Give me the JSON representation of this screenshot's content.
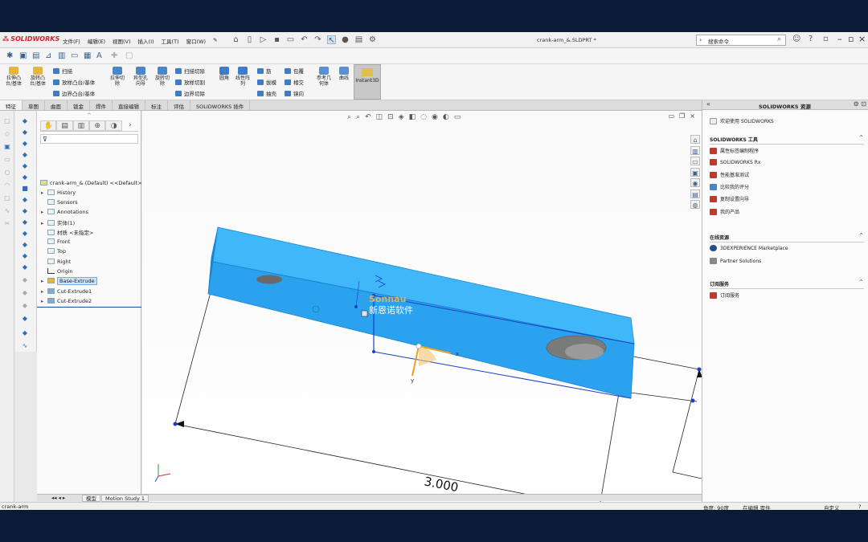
{
  "app": {
    "logo_text": "SOLIDWORKS",
    "document_title": "crank-arm_&.SLDPRT *",
    "search_label": "搜索命令",
    "menu": [
      "文件(F)",
      "编辑(E)",
      "视图(V)",
      "插入(I)",
      "工具(T)",
      "窗口(W)"
    ]
  },
  "commands": {
    "large": [
      {
        "label": "拉伸凸\n台/基体"
      },
      {
        "label": "旋转凸\n台/基体"
      },
      {
        "label": "拉伸切\n除"
      },
      {
        "label": "异型孔\n向导"
      },
      {
        "label": "旋转切\n除"
      },
      {
        "label": "圆角"
      },
      {
        "label": "线性阵\n列"
      },
      {
        "label": "参考几\n何体"
      },
      {
        "label": "曲线"
      }
    ],
    "small": [
      "扫描",
      "放样凸台/基体",
      "边界凸台/基体",
      "扫描切除",
      "放样切割",
      "边界切除",
      "筋",
      "拔模",
      "抽壳",
      "包覆",
      "相交",
      "镜向"
    ],
    "instant3d": "Instant3D"
  },
  "tabs": [
    "特征",
    "草图",
    "曲面",
    "钣金",
    "焊件",
    "直接编辑",
    "标注",
    "评估",
    "SOLIDWORKS 插件"
  ],
  "tree": {
    "root": "crank-arm_& (Default) <<Default>",
    "items": [
      {
        "label": "History",
        "exp": "▸"
      },
      {
        "label": "Sensors",
        "exp": ""
      },
      {
        "label": "Annotations",
        "exp": "▸"
      },
      {
        "label": "实体(1)",
        "exp": "▸"
      },
      {
        "label": "材质 <未指定>",
        "exp": ""
      },
      {
        "label": "Front",
        "exp": ""
      },
      {
        "label": "Top",
        "exp": ""
      },
      {
        "label": "Right",
        "exp": ""
      },
      {
        "label": "Origin",
        "exp": ""
      },
      {
        "label": "Base-Extrude",
        "exp": "▸",
        "selected": true
      },
      {
        "label": "Cut-Extrude1",
        "exp": "▸"
      },
      {
        "label": "Cut-Extrude2",
        "exp": "▸"
      }
    ]
  },
  "viewport": {
    "watermark_en": "Sonnau",
    "watermark_cn": "新恩诺软件",
    "dimension_value": "3.000",
    "triad_x": "x",
    "triad_y": "y",
    "part_color": "#2fa7f0",
    "accent_color": "#1b3fc7"
  },
  "bottom_tabs": [
    "模型",
    "Motion Study 1"
  ],
  "status": {
    "left": "crank-arm",
    "angle": "角度: 90度",
    "mode": "在编辑 零件",
    "units": "自定义"
  },
  "taskpane": {
    "title": "SOLIDWORKS 资源",
    "welcome": "欢迎使用 SOLIDWORKS",
    "sections": [
      {
        "title": "SOLIDWORKS 工具",
        "items": [
          "属性标签编制程序",
          "SOLIDWORKS Rx",
          "性能基准测试",
          "比较我的评分",
          "复制设置向导",
          "我的产品"
        ]
      },
      {
        "title": "在线资源",
        "items": [
          "3DEXPERIENCE Marketplace",
          "Partner Solutions"
        ]
      },
      {
        "title": "订阅服务",
        "items": [
          "订阅服务"
        ]
      }
    ]
  }
}
